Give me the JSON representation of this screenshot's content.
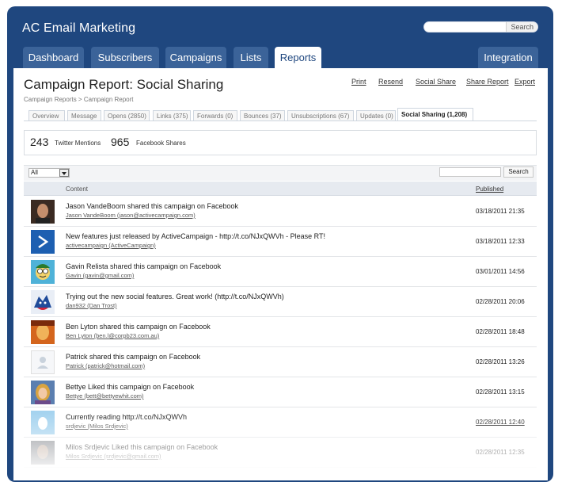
{
  "app": {
    "title": "AC Email Marketing"
  },
  "top_search": {
    "button": "Search",
    "placeholder": ""
  },
  "nav": {
    "tabs": [
      "Dashboard",
      "Subscribers",
      "Campaigns",
      "Lists",
      "Reports"
    ],
    "integration": "Integration",
    "active": "Reports"
  },
  "page": {
    "title": "Campaign Report: Social Sharing",
    "breadcrumb": "Campaign Reports > Campaign Report",
    "links": [
      "Print",
      "Resend",
      "Social Share",
      "Share Report",
      "Export"
    ]
  },
  "subtabs": [
    "Overview",
    "Message",
    "Opens (2850)",
    "Links (375)",
    "Forwards (0)",
    "Bounces (37)",
    "Unsubscriptions (67)",
    "Updates (0)",
    "Social Sharing (1,208)"
  ],
  "stats": {
    "twitter_count": "243",
    "twitter_label": "Twitter Mentions",
    "facebook_count": "965",
    "facebook_label": "Facebook Shares"
  },
  "filter": {
    "selected": "All",
    "search_button": "Search"
  },
  "table": {
    "col_content": "Content",
    "col_published": "Published",
    "rows": [
      {
        "title": "Jason VandeBoom shared this campaign on Facebook",
        "sub": "Jason VandeBoom (jason@activecampaign.com)",
        "date": "03/18/2011 21:35",
        "avatar": "man-photo-icon"
      },
      {
        "title": "New features just released by ActiveCampaign - http://t.co/NJxQWVh - Please RT!",
        "sub": "activecampaign (ActiveCampaign)",
        "date": "03/18/2011 12:33",
        "avatar": "activecampaign-logo-icon"
      },
      {
        "title": "Gavin Relista shared this campaign on Facebook",
        "sub": "Gavin (gavin@gmail.com)",
        "date": "03/01/2011 14:56",
        "avatar": "cartoon-avatar-icon"
      },
      {
        "title": "Trying out the new social features. Great work! (http://t.co/NJxQWVh)",
        "sub": "dan932 (Dan Trost)",
        "date": "02/28/2011 20:06",
        "avatar": "mascot-avatar-icon"
      },
      {
        "title": "Ben Lyton shared this campaign on Facebook",
        "sub": "Ben Lyton (ben.l@corpb23.com.au)",
        "date": "02/28/2011 18:48",
        "avatar": "man-photo-icon"
      },
      {
        "title": "Patrick shared this campaign on Facebook",
        "sub": "Patrick (patrick@hotmail.com)",
        "date": "02/28/2011 13:26",
        "avatar": "default-user-icon"
      },
      {
        "title": "Bettye Liked this campaign on Facebook",
        "sub": "Bettye (bett@bettyewhit.com)",
        "date": "02/28/2011 13:15",
        "avatar": "woman-photo-icon"
      },
      {
        "title": "Currently reading http://t.co/NJxQWVh",
        "sub": "srdjevic (Milos Srdjevic)",
        "date": "02/28/2011 12:40",
        "avatar": "egg-avatar-icon"
      },
      {
        "title": "Milos Srdjevic Liked this campaign on Facebook",
        "sub": "Milos Srdjevic (srdjevic@gmail.com)",
        "date": "02/28/2011 12:35",
        "avatar": "man-photo-icon"
      }
    ]
  },
  "colors": {
    "brand": "#1f477f",
    "tab": "#3b6399",
    "logo": "#1d5fb1"
  }
}
